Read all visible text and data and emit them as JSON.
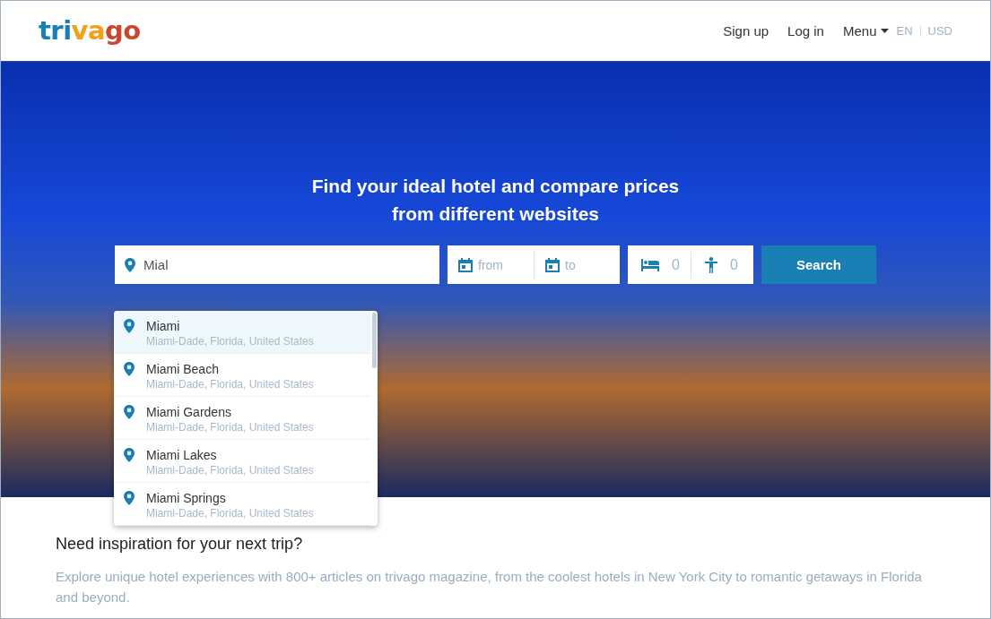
{
  "logo": [
    {
      "text": "tri",
      "color": "#1a7fb4"
    },
    {
      "text": "va",
      "color": "#f4a01b"
    },
    {
      "text": "go",
      "color": "#c9472f"
    }
  ],
  "nav": {
    "links": [
      "Sign up",
      "Log in"
    ],
    "menu": "Menu",
    "language": "EN",
    "currency": "USD"
  },
  "hero": {
    "headline": [
      "Find your ideal hotel and compare prices",
      "from different websites"
    ]
  },
  "search": {
    "destination": "Mial",
    "check_in": {
      "placeholder": "from"
    },
    "check_out": {
      "placeholder": "to"
    },
    "rooms": "0",
    "guests": "0",
    "button": "Search"
  },
  "suggestions": [
    {
      "name": "Miami",
      "region": "Miami-Dade, Florida, United States",
      "selected": true
    },
    {
      "name": "Miami Beach",
      "region": "Miami-Dade, Florida, United States",
      "selected": false
    },
    {
      "name": "Miami Gardens",
      "region": "Miami-Dade, Florida, United States",
      "selected": false
    },
    {
      "name": "Miami Lakes",
      "region": "Miami-Dade, Florida, United States",
      "selected": false
    },
    {
      "name": "Miami Springs",
      "region": "Miami-Dade, Florida, United States",
      "selected": false
    }
  ],
  "inspiration": {
    "title": "Need inspiration for your next trip?",
    "text": "Explore unique hotel experiences with 800+ articles on trivago magazine, from the coolest hotels in New York City to romantic getaways in Florida and beyond."
  }
}
